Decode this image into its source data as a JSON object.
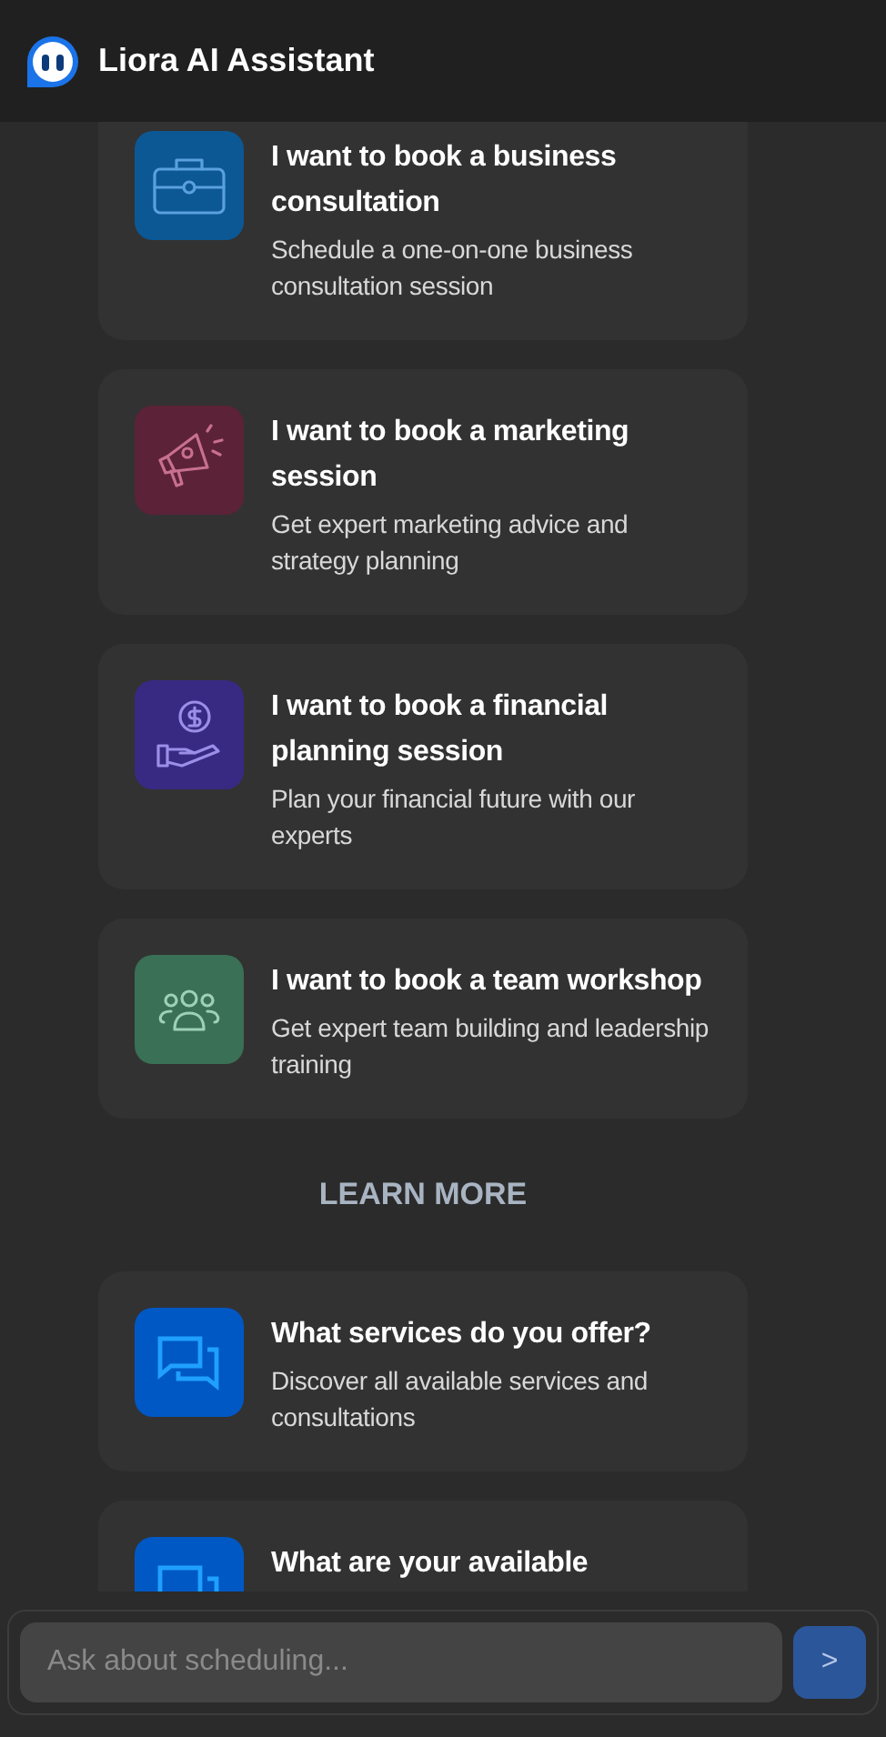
{
  "header": {
    "title": "Liora AI Assistant"
  },
  "booking_options": [
    {
      "kind": "briefcase",
      "color": "#0c5894",
      "title": "I want to book a business consultation",
      "description": "Schedule a one-on-one business consultation session"
    },
    {
      "kind": "megaphone",
      "color": "#5c2238",
      "title": "I want to book a marketing session",
      "description": "Get expert marketing advice and strategy planning"
    },
    {
      "kind": "money",
      "color": "#382a82",
      "title": "I want to book a financial planning session",
      "description": "Plan your financial future with our experts"
    },
    {
      "kind": "team",
      "color": "#3a7056",
      "title": "I want to book a team workshop",
      "description": "Get expert team building and leadership training"
    }
  ],
  "learn_more": {
    "heading": "LEARN MORE",
    "items": [
      {
        "kind": "chat",
        "color": "#0058c4",
        "title": "What services do you offer?",
        "description": "Discover all available services and consultations"
      },
      {
        "kind": "chat",
        "color": "#0058c4",
        "title": "What are your available"
      }
    ]
  },
  "composer": {
    "placeholder": "Ask about scheduling...",
    "send": ">"
  }
}
